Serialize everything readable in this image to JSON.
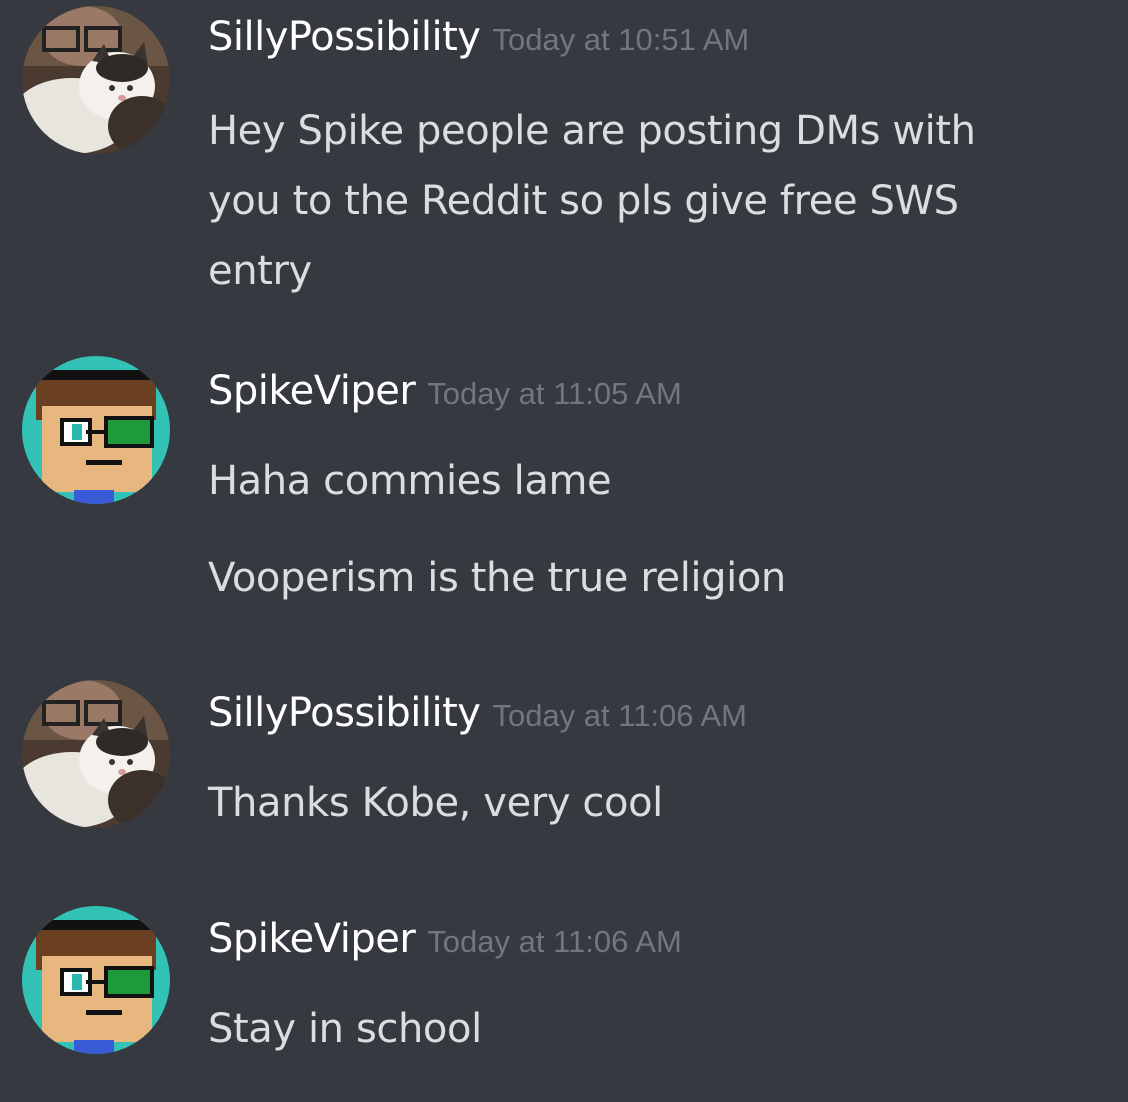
{
  "messages": [
    {
      "author": "SillyPossibility",
      "timestamp": "Today at 10:51 AM",
      "avatar": "cat-photo-avatar",
      "lines": [
        "Hey Spike people are posting DMs with",
        "you to the Reddit so pls give free SWS",
        "entry"
      ]
    },
    {
      "author": "SpikeViper",
      "timestamp": "Today at 11:05 AM",
      "avatar": "pixel-character-avatar",
      "lines": [
        "Haha commies lame",
        "Vooperism is the true religion"
      ]
    },
    {
      "author": "SillyPossibility",
      "timestamp": "Today at 11:06 AM",
      "avatar": "cat-photo-avatar",
      "lines": [
        "Thanks Kobe, very cool"
      ]
    },
    {
      "author": "SpikeViper",
      "timestamp": "Today at 11:06 AM",
      "avatar": "pixel-character-avatar",
      "lines": [
        "Stay in school"
      ]
    }
  ],
  "colors": {
    "background": "#36393f",
    "username": "#ffffff",
    "timestamp": "#72767d",
    "text": "#dcddde",
    "pixel_avatar_bg": "#33c3b6"
  }
}
